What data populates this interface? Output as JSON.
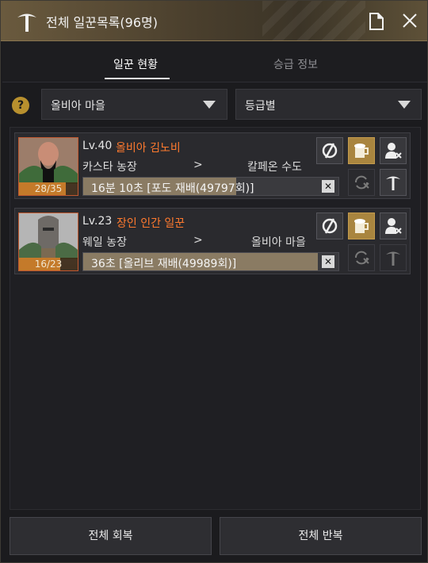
{
  "window": {
    "title": "전체 일꾼목록(96명)"
  },
  "tabs": [
    {
      "label": "일꾼 현황",
      "active": true
    },
    {
      "label": "승급 정보",
      "active": false
    }
  ],
  "filters": {
    "help_symbol": "?",
    "town_select": "올비아 마을",
    "sort_select": "등급별"
  },
  "workers": [
    {
      "level": "Lv.40",
      "name": "올비아 김노비",
      "stamina": "28/35",
      "stamina_fraction": 0.8,
      "farm": "카스타 농장",
      "arrow": ">",
      "destination": "칼페온 수도",
      "task": "16분 10초 [포도 재배(49797회)]",
      "progress_fraction": 0.6
    },
    {
      "level": "Lv.23",
      "name": "장인 인간 일꾼",
      "stamina": "16/23",
      "stamina_fraction": 0.7,
      "farm": "웨일 농장",
      "arrow": ">",
      "destination": "올비아 마을",
      "task": "36초 [올리브 재배(49989회)]",
      "progress_fraction": 0.92
    }
  ],
  "bottom_buttons": {
    "recover_all": "전체 회복",
    "repeat_all": "전체 반복"
  },
  "colors": {
    "accent_gold": "#a9853f",
    "worker_name": "#ff7a2e"
  }
}
